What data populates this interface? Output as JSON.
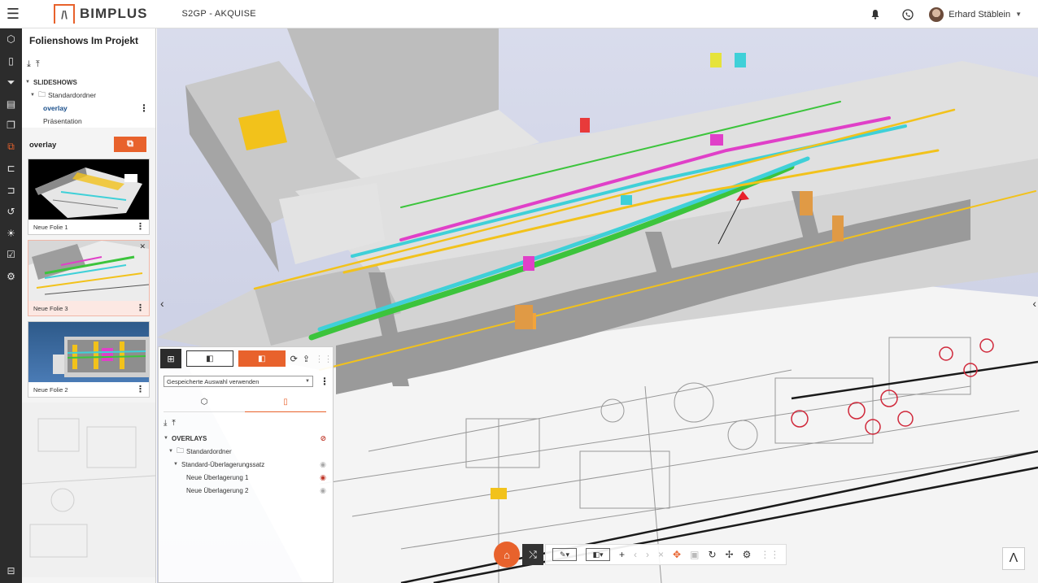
{
  "app": {
    "logo_text": "BIMPLUS",
    "project": "S2GP  - AKQUISE",
    "user_name": "Erhard Stäblein"
  },
  "sidebar": {
    "title": "Folienshows Im Projekt",
    "tree": {
      "root": "SLIDESHOWS",
      "folder": "Standardordner",
      "items": [
        "overlay",
        "Präsentation"
      ]
    },
    "selected_show": "overlay",
    "slides": [
      {
        "label": "Neue Folie 1"
      },
      {
        "label": "Neue Folie 3"
      },
      {
        "label": "Neue Folie 2"
      }
    ]
  },
  "overlay_panel": {
    "selection_value": "Gespeicherte Auswahl verwenden",
    "tree": {
      "root": "OVERLAYS",
      "folder": "Standardordner",
      "set": "Standard-Überlagerungssatz",
      "items": [
        "Neue Überlagerung 1",
        "Neue Überlagerung 2"
      ]
    }
  },
  "icons": {
    "menu": "hamburger-icon",
    "notifications": "bell-icon",
    "phone": "phone-icon",
    "home": "home-icon",
    "settings": "gear-icon"
  },
  "colors": {
    "accent": "#e8622c",
    "rail": "#2c2c2c",
    "pipe_cyan": "#3fd0d8",
    "pipe_green": "#3cc43c",
    "pipe_magenta": "#e040c8",
    "steel_yellow": "#f2c21b"
  }
}
